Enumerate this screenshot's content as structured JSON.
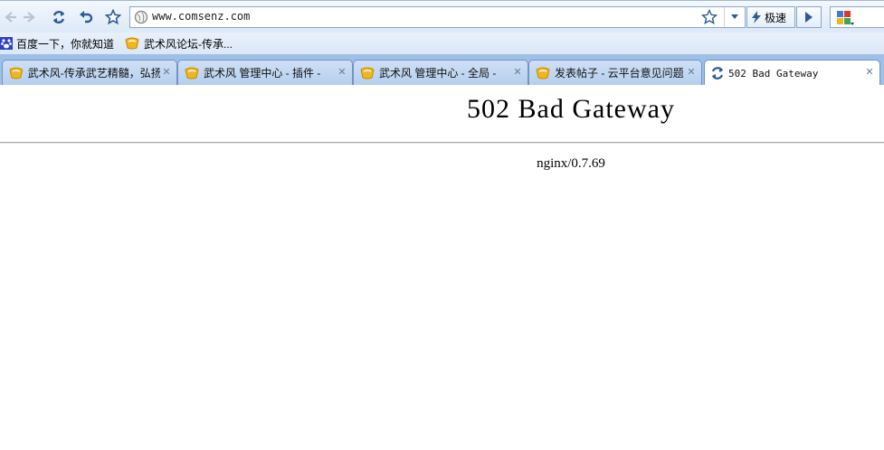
{
  "toolbar": {
    "url": "www.comsenz.com",
    "speed_label": "极速"
  },
  "bookmarks": [
    {
      "label": "百度一下，你就知道",
      "icon": "paw-icon"
    },
    {
      "label": "武术风论坛-传承...",
      "icon": "discuz-icon"
    }
  ],
  "tabs": [
    {
      "label": "武术风-传承武艺精髓，弘扬",
      "icon": "discuz-icon",
      "active": false
    },
    {
      "label": "武术风 管理中心 - 插件 -",
      "icon": "discuz-icon",
      "active": false
    },
    {
      "label": "武术风 管理中心 - 全局 -",
      "icon": "discuz-icon",
      "active": false
    },
    {
      "label": "发表帖子 - 云平台意见问题",
      "icon": "discuz-icon",
      "active": false
    },
    {
      "label": "502 Bad Gateway",
      "icon": "loading-icon",
      "active": true
    }
  ],
  "page": {
    "heading": "502 Bad Gateway",
    "server": "nginx/0.7.69"
  },
  "colors": {
    "toolbar_bg": "#e4eef9",
    "tabstrip_bg": "#9ebfe6",
    "icon_blue": "#2d5b9a",
    "discuz_yellow": "#f2b51c"
  }
}
